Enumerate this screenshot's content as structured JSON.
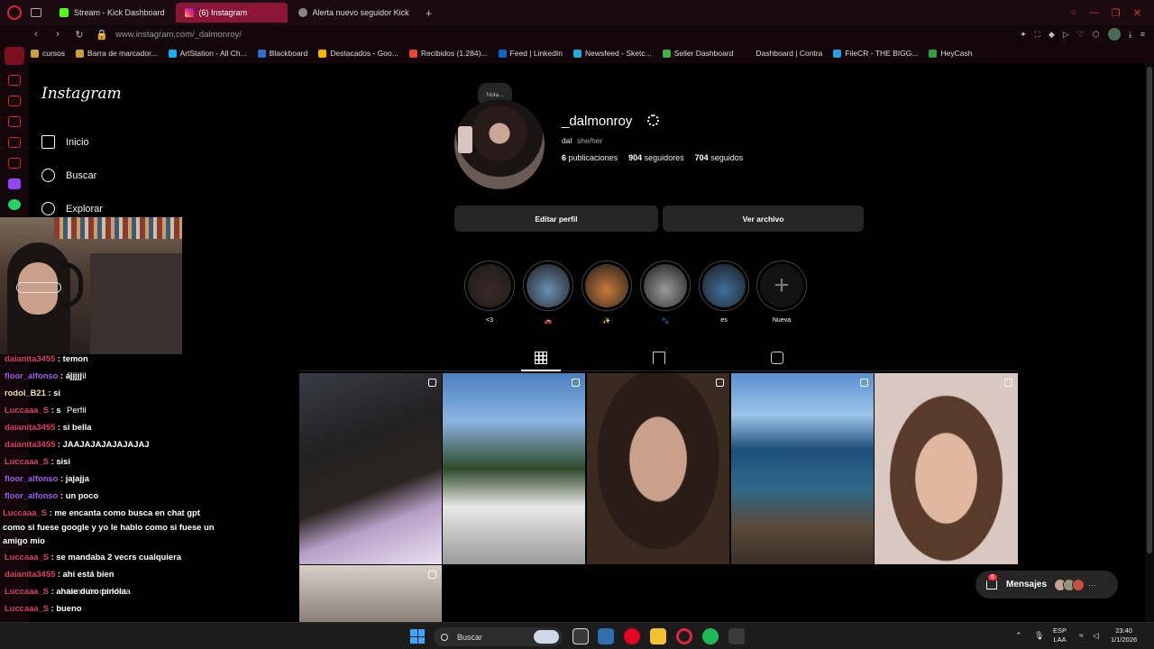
{
  "browser": {
    "tabs": [
      {
        "label": "Stream - Kick Dashboard",
        "active": false
      },
      {
        "label": "(6) Instagram",
        "active": true
      },
      {
        "label": "Alerta nuevo seguidor Kick",
        "active": false
      }
    ],
    "new_tab": "+",
    "url": "www.instagram.com/_dalmonroy/",
    "bookmarks": [
      {
        "label": "cursos",
        "icon": "folder-icon"
      },
      {
        "label": "Barra de marcador...",
        "icon": "folder-icon"
      },
      {
        "label": "ArtStation - All Ch...",
        "icon": "artstation-icon"
      },
      {
        "label": "Blackboard",
        "icon": "blackboard-icon"
      },
      {
        "label": "Destacados - Goo...",
        "icon": "drive-icon"
      },
      {
        "label": "Recibidos (1.284)...",
        "icon": "gmail-icon"
      },
      {
        "label": "Feed | LinkedIn",
        "icon": "linkedin-icon"
      },
      {
        "label": "Newsfeed - Sketc...",
        "icon": "sketchfab-icon"
      },
      {
        "label": "Seller Dashboard",
        "icon": "seller-icon"
      },
      {
        "label": "Dashboard | Contra",
        "icon": "contra-icon"
      },
      {
        "label": "FileCR - THE BIGG...",
        "icon": "filecr-icon"
      },
      {
        "label": "HeyCash",
        "icon": "dollar-icon"
      }
    ]
  },
  "instagram": {
    "logo": "Instagram",
    "nav": [
      {
        "label": "Inicio",
        "icon": "home-icon"
      },
      {
        "label": "Buscar",
        "icon": "search-icon"
      },
      {
        "label": "Explorar",
        "icon": "compass-icon"
      }
    ],
    "ghost_nav": {
      "perfil": "Perfil",
      "meta": "también de Meta"
    },
    "profile": {
      "note": "Nota...",
      "username": "_dalmonroy",
      "display_name": "dal",
      "pronouns": "she/her",
      "posts_count": "6",
      "posts_label": "publicaciones",
      "followers_count": "904",
      "followers_label": "seguidores",
      "following_count": "704",
      "following_label": "seguidos",
      "edit_button": "Editar perfil",
      "archive_button": "Ver archivo"
    },
    "highlights": [
      {
        "label": "<3",
        "color": "#3a2a25"
      },
      {
        "label": "🚗",
        "color": "#6c8fb0"
      },
      {
        "label": "✨",
        "color": "#c87a3a"
      },
      {
        "label": "🐾",
        "color": "#9a9a9a"
      },
      {
        "label": "es",
        "color": "#3f6f9a"
      },
      {
        "label": "Nueva",
        "color": "#121212"
      }
    ],
    "messages": {
      "label": "Mensajes",
      "badge": "6",
      "more": "···"
    }
  },
  "chat": [
    {
      "user": "daianita3455",
      "color": "#e0406a",
      "text": " : temon"
    },
    {
      "user": "floor_alfonso",
      "color": "#a35cf0",
      "text": " : ajjjjj"
    },
    {
      "user": "rodol_B21",
      "color": "#f0e0a0",
      "text": " : si"
    },
    {
      "user": "Luccaaa_S",
      "color": "#e0406a",
      "text": " : s"
    },
    {
      "user": "daianita3455",
      "color": "#e0406a",
      "text": " : si bella"
    },
    {
      "user": "daianita3455",
      "color": "#e0406a",
      "text": " : JAAJAJAJAJAJAJAJ"
    },
    {
      "user": "Luccaaa_S",
      "color": "#e0406a",
      "text": " : sisi"
    },
    {
      "user": "floor_alfonso",
      "color": "#a35cf0",
      "text": " : jajajja"
    },
    {
      "user": "floor_alfonso",
      "color": "#a35cf0",
      "text": " : un poco"
    },
    {
      "user": "Luccaaa_S",
      "color": "#e0406a",
      "text": " : me encanta como busca en chat gpt como si fuese google y yo le hablo como si fuese un amigo mio"
    },
    {
      "user": "Luccaaa_S",
      "color": "#e0406a",
      "text": " : se mandaba 2 vecrs cualquiera"
    },
    {
      "user": "daianita3455",
      "color": "#e0406a",
      "text": " : ahí está bien"
    },
    {
      "user": "Luccaaa_S",
      "color": "#e0406a",
      "text": " : ahaie duro pinola"
    },
    {
      "user": "Luccaaa_S",
      "color": "#e0406a",
      "text": " : bueno"
    }
  ],
  "taskbar": {
    "search": "Buscar",
    "lang_top": "ESP",
    "lang_bottom": "LAA",
    "time": "23:40",
    "date": "1/1/2026"
  },
  "colors": {
    "accent": "#8b1537",
    "opera": "#e0273a",
    "ig_button": "#262626"
  }
}
